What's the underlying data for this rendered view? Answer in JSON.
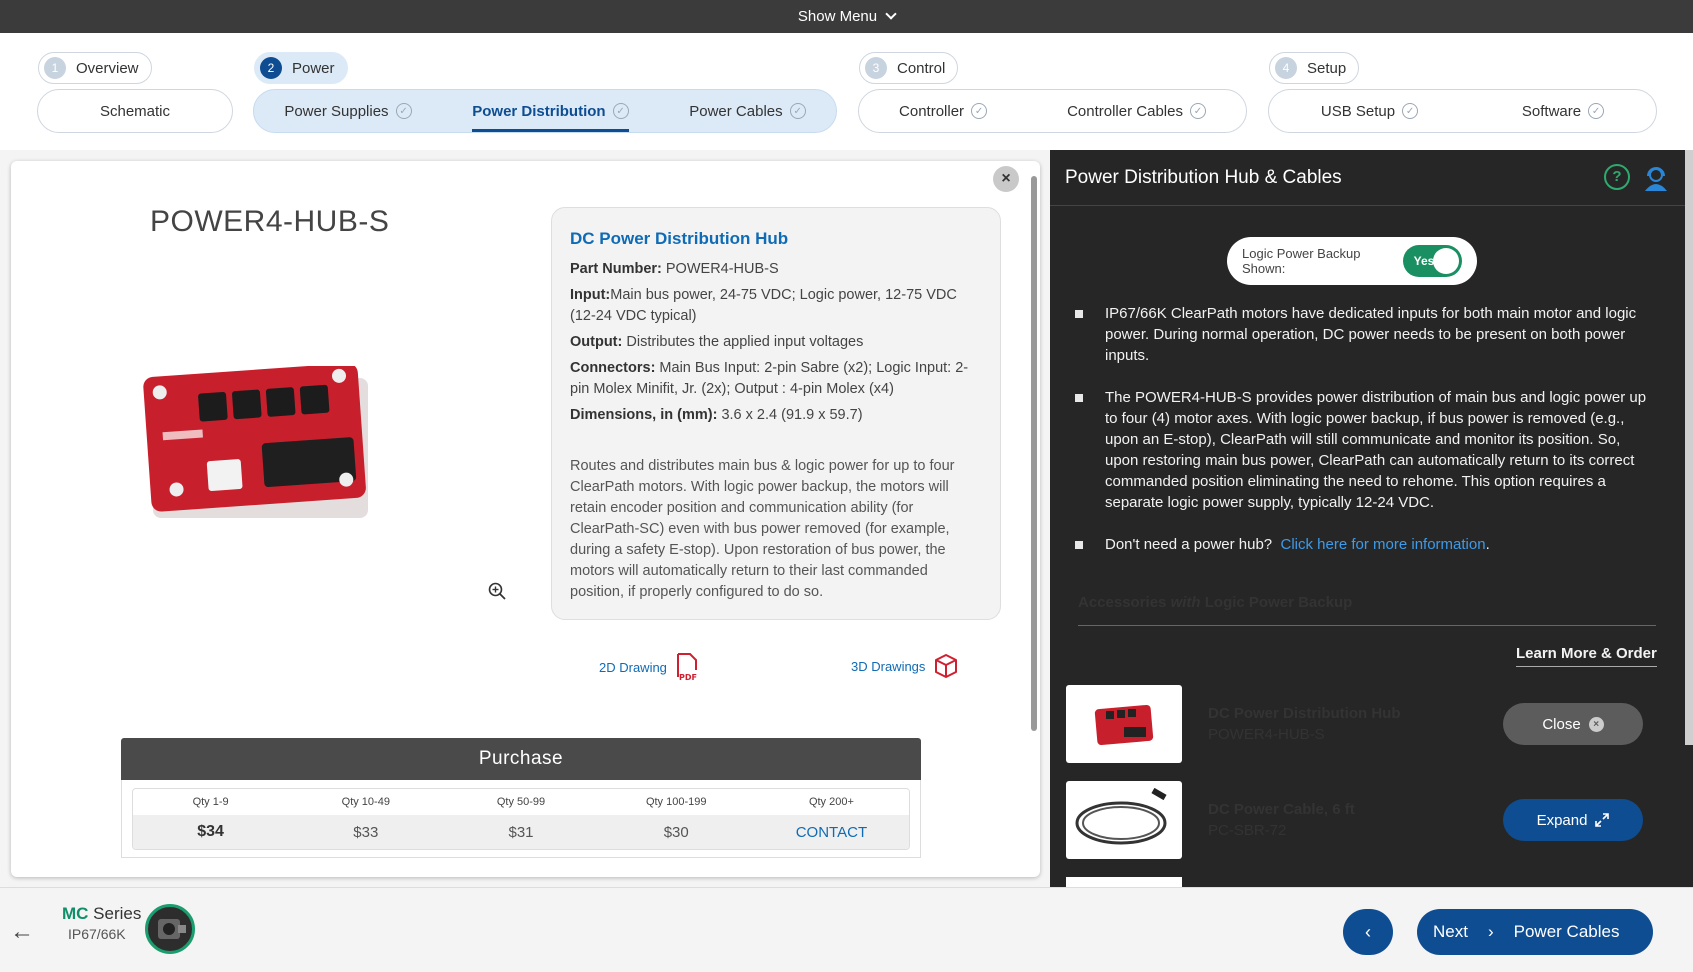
{
  "topbar": {
    "menu_label": "Show Menu"
  },
  "steps": [
    {
      "num": "1",
      "label": "Overview",
      "items": [
        "Schematic"
      ]
    },
    {
      "num": "2",
      "label": "Power",
      "items": [
        "Power Supplies",
        "Power Distribution",
        "Power Cables"
      ]
    },
    {
      "num": "3",
      "label": "Control",
      "items": [
        "Controller",
        "Controller Cables"
      ]
    },
    {
      "num": "4",
      "label": "Setup",
      "items": [
        "USB Setup",
        "Software"
      ]
    }
  ],
  "product": {
    "title": "POWER4-HUB-S",
    "spec_title": "DC Power Distribution Hub",
    "part_number_label": "Part Number:",
    "part_number": " POWER4-HUB-S",
    "input_label": "Input:",
    "input": "Main bus power, 24-75 VDC; Logic power, 12-75 VDC (12-24 VDC typical)",
    "output_label": "Output:",
    "output": " Distributes the applied input voltages",
    "connectors_label": "Connectors:",
    "connectors": " Main Bus Input: 2-pin Sabre (x2); Logic Input: 2-pin Molex Minifit, Jr. (2x); Output : 4-pin Molex (x4)",
    "dimensions_label": "Dimensions, in (mm):",
    "dimensions": " 3.6 x 2.4 (91.9 x 59.7)",
    "description": "Routes and distributes main bus & logic power for up to four ClearPath motors. With logic power backup, the motors will retain encoder position and communication ability (for ClearPath-SC) even with bus power removed (for example, during a safety E-stop). Upon restoration of bus power, the motors will automatically return to their last commanded position, if properly configured to do so.",
    "drawing_2d": "2D Drawing",
    "drawing_3d": "3D Drawings"
  },
  "purchase": {
    "title": "Purchase",
    "qty": [
      "Qty 1-9",
      "Qty 10-49",
      "Qty 50-99",
      "Qty 100-199",
      "Qty 200+"
    ],
    "prices": [
      "$34",
      "$33",
      "$31",
      "$30",
      "CONTACT"
    ]
  },
  "panel": {
    "title": "Power Distribution Hub & Cables",
    "toggle_label": "Logic Power Backup Shown:",
    "toggle_value": "Yes",
    "bullets": [
      "IP67/66K ClearPath motors have dedicated inputs for both main motor and logic power. During normal operation, DC power needs to be present on both power inputs.",
      "The POWER4-HUB-S provides power distribution of main bus and logic power up to four (4) motor axes. With logic power backup, if bus power is removed (e.g., upon an E-stop), ClearPath will still communicate and monitor its position. So, upon restoring main bus power, ClearPath can automatically return to its correct commanded position eliminating the need to rehome. This option requires a separate logic power supply, typically 12-24 VDC."
    ],
    "bullet3_text": "Don't need a power hub?",
    "bullet3_link": "Click here for more information",
    "bullet3_end": ".",
    "acc_prefix": "Accessories ",
    "acc_with": "with",
    "acc_suffix": " Logic Power Backup",
    "learn_more": "Learn More & Order",
    "accessories": [
      {
        "name": "DC Power Distribution Hub",
        "part": "POWER4-HUB-S",
        "button": "Close"
      },
      {
        "name": "DC Power Cable, 6 ft",
        "part": "PC-SBR-72",
        "button": "Expand"
      }
    ]
  },
  "bottom": {
    "series_brand": "MC",
    "series_label": " Series",
    "series_rating": "IP67/66K",
    "next_label": "Next",
    "next_target": "Power Cables"
  },
  "colors": {
    "brand_blue": "#0f4d92",
    "link_blue": "#0f6bb5",
    "green": "#1a8f62",
    "panel_bg": "#262626"
  }
}
